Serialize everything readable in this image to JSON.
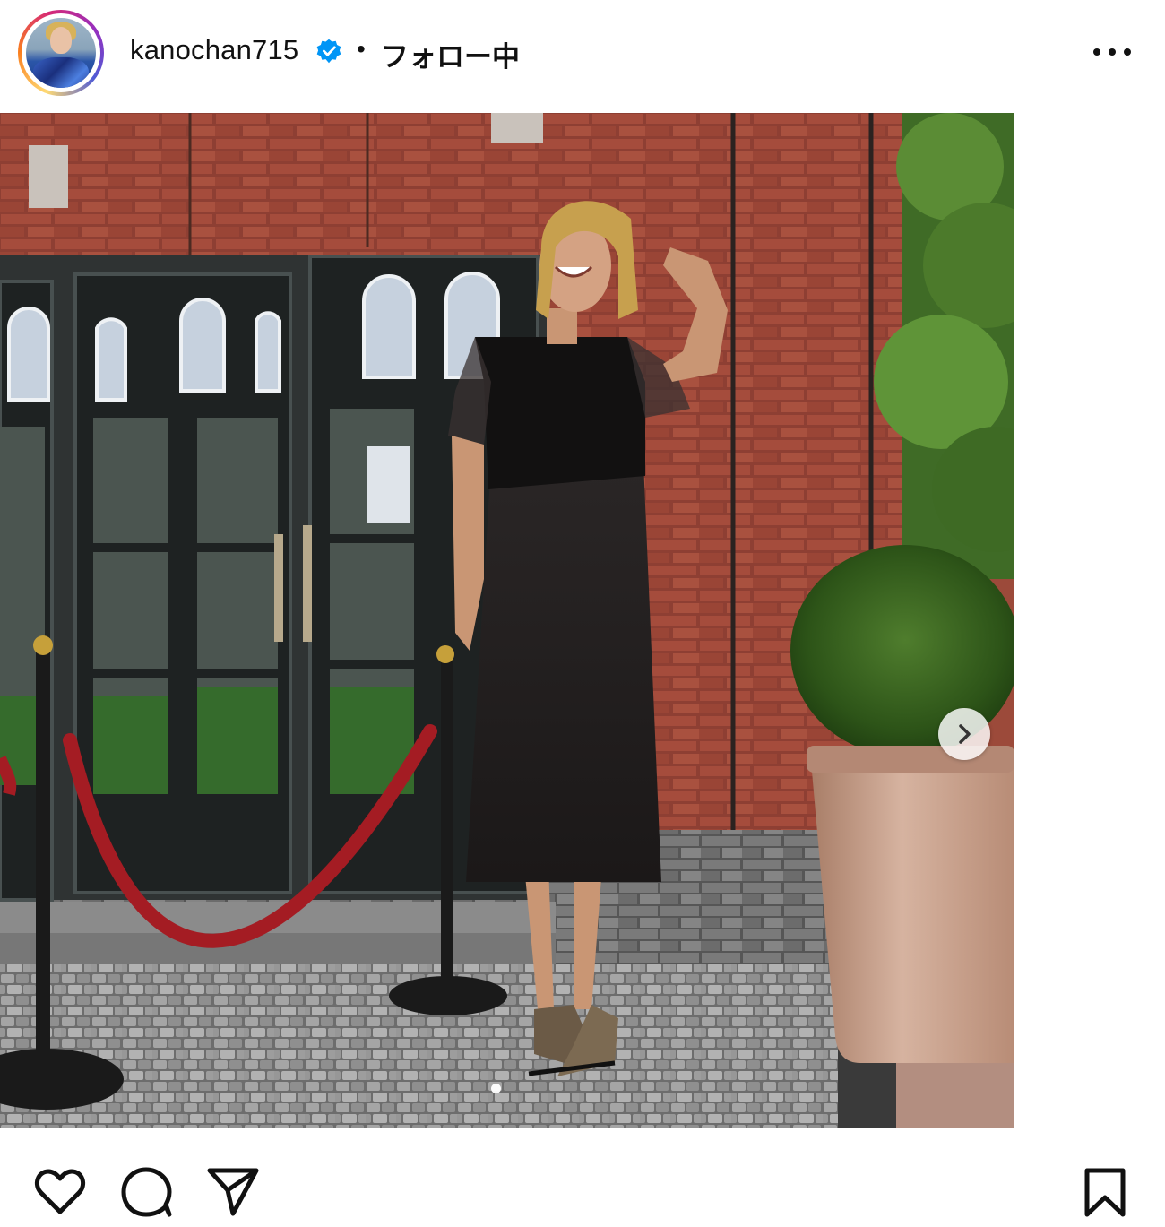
{
  "header": {
    "username": "kanochan715",
    "separator": "•",
    "follow_status": "フォロー中",
    "verified": true,
    "avatar_icon": "profile-avatar",
    "more_icon": "more-options-icon"
  },
  "post": {
    "image_description_icon": "post-photo",
    "carousel": {
      "next_icon": "chevron-right-icon",
      "current_index": 1,
      "visible_dots": 1
    },
    "tagged_user_icon": "person-icon"
  },
  "actions": {
    "like_icon": "heart-icon",
    "comment_icon": "comment-icon",
    "share_icon": "send-icon",
    "save_icon": "bookmark-icon"
  },
  "colors": {
    "verified_blue": "#0095f6",
    "text": "#111111",
    "ring_start": "#feda75",
    "ring_end": "#d62976"
  }
}
